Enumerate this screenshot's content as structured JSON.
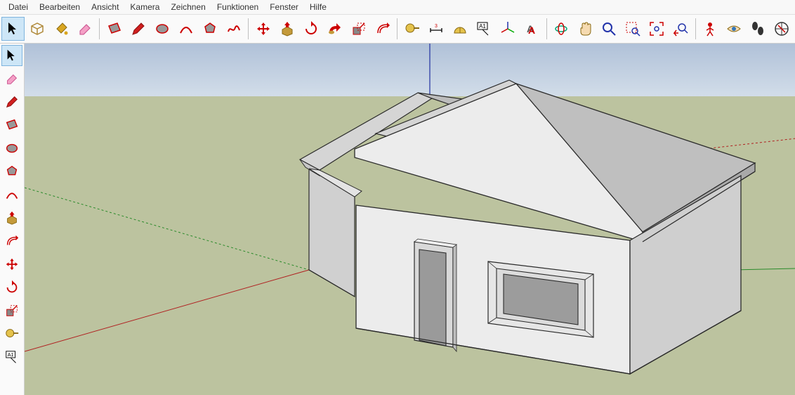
{
  "menu": {
    "items": [
      "Datei",
      "Bearbeiten",
      "Ansicht",
      "Kamera",
      "Zeichnen",
      "Funktionen",
      "Fenster",
      "Hilfe"
    ]
  },
  "top_toolbar": {
    "groups": [
      [
        "select",
        "make-component",
        "paint-bucket",
        "eraser"
      ],
      [
        "rectangle",
        "pencil",
        "circle",
        "arc",
        "polygon",
        "freehand"
      ],
      [
        "move",
        "push-pull",
        "rotate",
        "follow-me",
        "scale",
        "offset"
      ],
      [
        "tape-measure",
        "dimension",
        "protractor",
        "text-label",
        "axes",
        "3d-text"
      ],
      [
        "orbit",
        "pan",
        "zoom",
        "zoom-extents",
        "previous",
        "next"
      ],
      [
        "position-camera",
        "look-around",
        "walk",
        "section-plane"
      ]
    ],
    "selected": "select"
  },
  "side_toolbar": {
    "items": [
      "select",
      "eraser",
      "pencil",
      "rectangle",
      "circle",
      "polygon",
      "arc",
      "push-pull",
      "offset-side",
      "move",
      "rotate",
      "scale",
      "tape-measure",
      "text-label"
    ],
    "selected": "select"
  },
  "viewport": {
    "description": "3D perspective view of a simple white house on a green ground plane with a blue-grey sky. Gable-roof house with a front door and a square window. Red, green and blue axis guide lines radiate from the origin."
  }
}
